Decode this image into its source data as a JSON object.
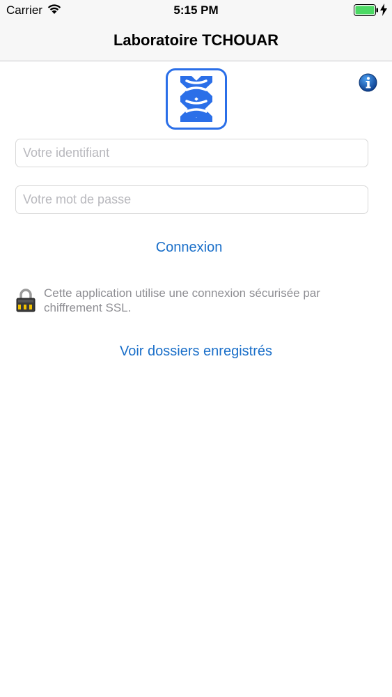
{
  "status_bar": {
    "carrier": "Carrier",
    "time": "5:15 PM",
    "battery_level": 1.0,
    "battery_color": "#4cd964"
  },
  "nav": {
    "title": "Laboratoire TCHOUAR"
  },
  "logo": {
    "icon": "dna-helix-icon",
    "color": "#2b6fe8"
  },
  "info": {
    "icon": "info-icon",
    "color": "#1560bd"
  },
  "form": {
    "login_placeholder": "Votre identifiant",
    "login_value": "",
    "password_placeholder": "Votre mot de passe",
    "password_value": "",
    "submit_label": "Connexion"
  },
  "ssl_notice": {
    "icon": "padlock-icon",
    "text": "Cette application utilise une connexion sécurisée par chiffrement SSL."
  },
  "saved_link": {
    "label": "Voir dossiers enregistrés"
  },
  "colors": {
    "accent": "#1a6fc9",
    "muted_text": "#8e8e93"
  }
}
